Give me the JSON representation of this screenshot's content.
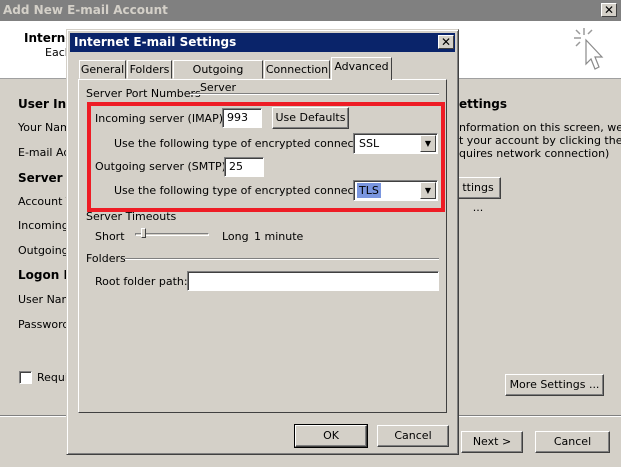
{
  "outer": {
    "title": "Add New E-mail Account",
    "header_title": "Interne",
    "header_sub": "Each",
    "sections": {
      "user_info": "User Info",
      "your_name": "Your Name",
      "email_address": "E-mail Adc",
      "server_info": "Server In",
      "account_type": "Account T",
      "incoming": "Incoming r",
      "outgoing": "Outgoing r",
      "logon_info": "Logon In",
      "user_name": "User Name",
      "password": "Password:",
      "require": "Requir"
    },
    "right": {
      "settings_heading": "ettings",
      "desc_line1": "nformation on this screen, we",
      "desc_line2": "t your account by clicking the",
      "desc_line3": "quires network connection)",
      "test_btn_label": "ttings ...",
      "more_settings_label": "More Settings ..."
    },
    "buttons": {
      "next": "Next >",
      "cancel": "Cancel"
    }
  },
  "dialog": {
    "title": "Internet E-mail Settings",
    "tabs": [
      "General",
      "Folders",
      "Outgoing Server",
      "Connection",
      "Advanced"
    ],
    "active_tab": "Advanced",
    "server_ports": {
      "group_label": "Server Port Numbers",
      "incoming_label": "Incoming server (IMAP):",
      "incoming_value": "993",
      "use_defaults": "Use Defaults",
      "incoming_enc_label": "Use the following type of encrypted connection:",
      "incoming_enc_value": "SSL",
      "outgoing_label": "Outgoing server (SMTP):",
      "outgoing_value": "25",
      "outgoing_enc_label": "Use the following type of encrypted connection:",
      "outgoing_enc_value": "TLS"
    },
    "timeouts": {
      "group_label": "Server Timeouts",
      "short": "Short",
      "long": "Long",
      "value": "1 minute",
      "slider_level": 0.05
    },
    "folders": {
      "group_label": "Folders",
      "root_label": "Root folder path:",
      "root_value": ""
    },
    "buttons": {
      "ok": "OK",
      "cancel": "Cancel"
    }
  },
  "colors": {
    "highlight": "#ee1c25",
    "dialog_title_bg": "#0a246a"
  }
}
